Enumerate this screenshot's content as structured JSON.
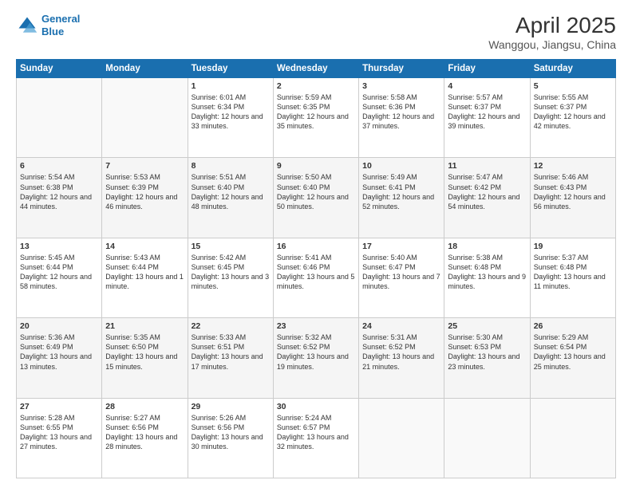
{
  "logo": {
    "line1": "General",
    "line2": "Blue"
  },
  "title": "April 2025",
  "subtitle": "Wanggou, Jiangsu, China",
  "days_header": [
    "Sunday",
    "Monday",
    "Tuesday",
    "Wednesday",
    "Thursday",
    "Friday",
    "Saturday"
  ],
  "weeks": [
    [
      {
        "day": "",
        "info": ""
      },
      {
        "day": "",
        "info": ""
      },
      {
        "day": "1",
        "info": "Sunrise: 6:01 AM\nSunset: 6:34 PM\nDaylight: 12 hours and 33 minutes."
      },
      {
        "day": "2",
        "info": "Sunrise: 5:59 AM\nSunset: 6:35 PM\nDaylight: 12 hours and 35 minutes."
      },
      {
        "day": "3",
        "info": "Sunrise: 5:58 AM\nSunset: 6:36 PM\nDaylight: 12 hours and 37 minutes."
      },
      {
        "day": "4",
        "info": "Sunrise: 5:57 AM\nSunset: 6:37 PM\nDaylight: 12 hours and 39 minutes."
      },
      {
        "day": "5",
        "info": "Sunrise: 5:55 AM\nSunset: 6:37 PM\nDaylight: 12 hours and 42 minutes."
      }
    ],
    [
      {
        "day": "6",
        "info": "Sunrise: 5:54 AM\nSunset: 6:38 PM\nDaylight: 12 hours and 44 minutes."
      },
      {
        "day": "7",
        "info": "Sunrise: 5:53 AM\nSunset: 6:39 PM\nDaylight: 12 hours and 46 minutes."
      },
      {
        "day": "8",
        "info": "Sunrise: 5:51 AM\nSunset: 6:40 PM\nDaylight: 12 hours and 48 minutes."
      },
      {
        "day": "9",
        "info": "Sunrise: 5:50 AM\nSunset: 6:40 PM\nDaylight: 12 hours and 50 minutes."
      },
      {
        "day": "10",
        "info": "Sunrise: 5:49 AM\nSunset: 6:41 PM\nDaylight: 12 hours and 52 minutes."
      },
      {
        "day": "11",
        "info": "Sunrise: 5:47 AM\nSunset: 6:42 PM\nDaylight: 12 hours and 54 minutes."
      },
      {
        "day": "12",
        "info": "Sunrise: 5:46 AM\nSunset: 6:43 PM\nDaylight: 12 hours and 56 minutes."
      }
    ],
    [
      {
        "day": "13",
        "info": "Sunrise: 5:45 AM\nSunset: 6:44 PM\nDaylight: 12 hours and 58 minutes."
      },
      {
        "day": "14",
        "info": "Sunrise: 5:43 AM\nSunset: 6:44 PM\nDaylight: 13 hours and 1 minute."
      },
      {
        "day": "15",
        "info": "Sunrise: 5:42 AM\nSunset: 6:45 PM\nDaylight: 13 hours and 3 minutes."
      },
      {
        "day": "16",
        "info": "Sunrise: 5:41 AM\nSunset: 6:46 PM\nDaylight: 13 hours and 5 minutes."
      },
      {
        "day": "17",
        "info": "Sunrise: 5:40 AM\nSunset: 6:47 PM\nDaylight: 13 hours and 7 minutes."
      },
      {
        "day": "18",
        "info": "Sunrise: 5:38 AM\nSunset: 6:48 PM\nDaylight: 13 hours and 9 minutes."
      },
      {
        "day": "19",
        "info": "Sunrise: 5:37 AM\nSunset: 6:48 PM\nDaylight: 13 hours and 11 minutes."
      }
    ],
    [
      {
        "day": "20",
        "info": "Sunrise: 5:36 AM\nSunset: 6:49 PM\nDaylight: 13 hours and 13 minutes."
      },
      {
        "day": "21",
        "info": "Sunrise: 5:35 AM\nSunset: 6:50 PM\nDaylight: 13 hours and 15 minutes."
      },
      {
        "day": "22",
        "info": "Sunrise: 5:33 AM\nSunset: 6:51 PM\nDaylight: 13 hours and 17 minutes."
      },
      {
        "day": "23",
        "info": "Sunrise: 5:32 AM\nSunset: 6:52 PM\nDaylight: 13 hours and 19 minutes."
      },
      {
        "day": "24",
        "info": "Sunrise: 5:31 AM\nSunset: 6:52 PM\nDaylight: 13 hours and 21 minutes."
      },
      {
        "day": "25",
        "info": "Sunrise: 5:30 AM\nSunset: 6:53 PM\nDaylight: 13 hours and 23 minutes."
      },
      {
        "day": "26",
        "info": "Sunrise: 5:29 AM\nSunset: 6:54 PM\nDaylight: 13 hours and 25 minutes."
      }
    ],
    [
      {
        "day": "27",
        "info": "Sunrise: 5:28 AM\nSunset: 6:55 PM\nDaylight: 13 hours and 27 minutes."
      },
      {
        "day": "28",
        "info": "Sunrise: 5:27 AM\nSunset: 6:56 PM\nDaylight: 13 hours and 28 minutes."
      },
      {
        "day": "29",
        "info": "Sunrise: 5:26 AM\nSunset: 6:56 PM\nDaylight: 13 hours and 30 minutes."
      },
      {
        "day": "30",
        "info": "Sunrise: 5:24 AM\nSunset: 6:57 PM\nDaylight: 13 hours and 32 minutes."
      },
      {
        "day": "",
        "info": ""
      },
      {
        "day": "",
        "info": ""
      },
      {
        "day": "",
        "info": ""
      }
    ]
  ]
}
